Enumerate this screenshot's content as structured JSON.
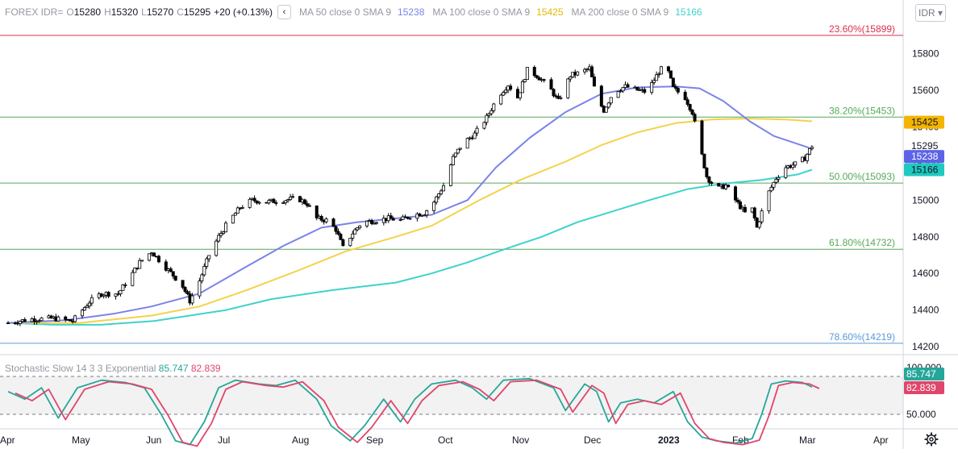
{
  "header": {
    "symbol": "FOREX IDR=",
    "open_label": "O",
    "open": "15280",
    "high_label": "H",
    "high": "15320",
    "low_label": "L",
    "low": "15270",
    "close_label": "C",
    "close": "15295",
    "change": "+20 (+0.13%)",
    "collapse_icon": "‹",
    "ma50_label": "MA 50 close 0 SMA 9",
    "ma50_value": "15238",
    "ma100_label": "MA 100 close 0 SMA 9",
    "ma100_value": "15425",
    "ma200_label": "MA 200 close 0 SMA 9",
    "ma200_value": "15166",
    "currency_button": "IDR ▾"
  },
  "colors": {
    "up": "#ffffff",
    "down": "#000000",
    "candle_border": "#000000",
    "ma50": "#7b83e8",
    "ma100": "#f4d24c",
    "ma200": "#3fd2cb",
    "fib_red": "#d9304f",
    "fib_green": "#57a85a",
    "fib_blue": "#5b9bd5",
    "stoch_k": "#26a69a",
    "stoch_d": "#e0456b"
  },
  "stochastic": {
    "label": "Stochastic Slow 14 3 3 Exponential",
    "k_value": "85.747",
    "d_value": "82.839",
    "axis_labels": [
      "100.000",
      "50.000"
    ]
  },
  "settings_icon": "gear-icon",
  "chart_data": {
    "type": "candlestick",
    "x_tick_labels": [
      "Apr",
      "May",
      "Jun",
      "Jul",
      "Aug",
      "Sep",
      "Oct",
      "Nov",
      "Dec",
      "2023",
      "Feb",
      "Mar",
      "Apr"
    ],
    "y_tick_labels": [
      "15800",
      "15600",
      "15400",
      "15200",
      "15000",
      "14800",
      "14600",
      "14400",
      "14200"
    ],
    "ylim": [
      14170,
      15960
    ],
    "fib_levels": [
      {
        "label": "23.60%(15899)",
        "value": 15899,
        "color": "fib_red"
      },
      {
        "label": "38.20%(15453)",
        "value": 15453,
        "color": "fib_green"
      },
      {
        "label": "50.00%(15093)",
        "value": 15093,
        "color": "fib_green"
      },
      {
        "label": "61.80%(14732)",
        "value": 14732,
        "color": "fib_green"
      },
      {
        "label": "78.60%(14219)",
        "value": 14219,
        "color": "fib_blue"
      }
    ],
    "price_badges": [
      {
        "text": "15425",
        "value": 15425,
        "bg": "#f4b400",
        "fg": "#131722"
      },
      {
        "text": "15295",
        "value": 15295,
        "bg": "#ffffff",
        "fg": "#131722"
      },
      {
        "text": "15238",
        "value": 15238,
        "bg": "#5d63e6",
        "fg": "#ffffff"
      },
      {
        "text": "15166",
        "value": 15166,
        "bg": "#1ec9c0",
        "fg": "#131722"
      }
    ],
    "price_keypoints": [
      [
        "2022-04-01",
        14330
      ],
      [
        "2022-04-10",
        14350
      ],
      [
        "2022-04-20",
        14355
      ],
      [
        "2022-04-28",
        14340
      ],
      [
        "2022-05-05",
        14445
      ],
      [
        "2022-05-10",
        14490
      ],
      [
        "2022-05-17",
        14490
      ],
      [
        "2022-05-22",
        14580
      ],
      [
        "2022-05-26",
        14660
      ],
      [
        "2022-05-31",
        14720
      ],
      [
        "2022-06-04",
        14660
      ],
      [
        "2022-06-09",
        14590
      ],
      [
        "2022-06-13",
        14530
      ],
      [
        "2022-06-16",
        14450
      ],
      [
        "2022-06-20",
        14560
      ],
      [
        "2022-06-24",
        14700
      ],
      [
        "2022-06-28",
        14800
      ],
      [
        "2022-07-02",
        14880
      ],
      [
        "2022-07-07",
        14960
      ],
      [
        "2022-07-12",
        15000
      ],
      [
        "2022-07-18",
        14990
      ],
      [
        "2022-07-25",
        15000
      ],
      [
        "2022-07-31",
        15010
      ],
      [
        "2022-08-04",
        14980
      ],
      [
        "2022-08-08",
        14900
      ],
      [
        "2022-08-12",
        14890
      ],
      [
        "2022-08-16",
        14840
      ],
      [
        "2022-08-19",
        14740
      ],
      [
        "2022-08-23",
        14820
      ],
      [
        "2022-08-27",
        14880
      ],
      [
        "2022-09-02",
        14890
      ],
      [
        "2022-09-07",
        14900
      ],
      [
        "2022-09-12",
        14890
      ],
      [
        "2022-09-17",
        14920
      ],
      [
        "2022-09-22",
        14930
      ],
      [
        "2022-09-26",
        14990
      ],
      [
        "2022-09-30",
        15080
      ],
      [
        "2022-10-04",
        15230
      ],
      [
        "2022-10-08",
        15310
      ],
      [
        "2022-10-13",
        15360
      ],
      [
        "2022-10-18",
        15450
      ],
      [
        "2022-10-23",
        15570
      ],
      [
        "2022-10-27",
        15630
      ],
      [
        "2022-10-31",
        15560
      ],
      [
        "2022-11-04",
        15710
      ],
      [
        "2022-11-08",
        15680
      ],
      [
        "2022-11-13",
        15620
      ],
      [
        "2022-11-17",
        15540
      ],
      [
        "2022-11-22",
        15680
      ],
      [
        "2022-11-27",
        15700
      ],
      [
        "2022-11-30",
        15720
      ],
      [
        "2022-12-03",
        15560
      ],
      [
        "2022-12-06",
        15490
      ],
      [
        "2022-12-10",
        15590
      ],
      [
        "2022-12-15",
        15620
      ],
      [
        "2022-12-20",
        15600
      ],
      [
        "2022-12-24",
        15590
      ],
      [
        "2022-12-29",
        15700
      ],
      [
        "2023-01-01",
        15740
      ],
      [
        "2023-01-04",
        15610
      ],
      [
        "2023-01-09",
        15560
      ],
      [
        "2023-01-12",
        15480
      ],
      [
        "2023-01-15",
        15300
      ],
      [
        "2023-01-18",
        15130
      ],
      [
        "2023-01-22",
        15060
      ],
      [
        "2023-01-26",
        15080
      ],
      [
        "2023-01-30",
        15000
      ],
      [
        "2023-02-03",
        14930
      ],
      [
        "2023-02-06",
        14950
      ],
      [
        "2023-02-08",
        14850
      ],
      [
        "2023-02-12",
        15020
      ],
      [
        "2023-02-16",
        15120
      ],
      [
        "2023-02-20",
        15180
      ],
      [
        "2023-02-25",
        15200
      ],
      [
        "2023-02-28",
        15230
      ],
      [
        "2023-03-03",
        15295
      ]
    ],
    "ma_keypoints": {
      "ma50": [
        [
          "2022-04-01",
          14330
        ],
        [
          "2022-04-25",
          14345
        ],
        [
          "2022-05-15",
          14380
        ],
        [
          "2022-05-31",
          14420
        ],
        [
          "2022-06-20",
          14490
        ],
        [
          "2022-07-10",
          14640
        ],
        [
          "2022-07-25",
          14750
        ],
        [
          "2022-08-10",
          14850
        ],
        [
          "2022-08-25",
          14880
        ],
        [
          "2022-09-10",
          14900
        ],
        [
          "2022-09-25",
          14920
        ],
        [
          "2022-10-10",
          15000
        ],
        [
          "2022-10-22",
          15180
        ],
        [
          "2022-11-05",
          15340
        ],
        [
          "2022-11-20",
          15480
        ],
        [
          "2022-12-05",
          15580
        ],
        [
          "2022-12-20",
          15615
        ],
        [
          "2023-01-05",
          15620
        ],
        [
          "2023-01-15",
          15610
        ],
        [
          "2023-01-25",
          15540
        ],
        [
          "2023-02-05",
          15430
        ],
        [
          "2023-02-15",
          15350
        ],
        [
          "2023-03-03",
          15280
        ]
      ],
      "ma100": [
        [
          "2022-04-01",
          14330
        ],
        [
          "2022-05-01",
          14330
        ],
        [
          "2022-05-31",
          14370
        ],
        [
          "2022-06-20",
          14420
        ],
        [
          "2022-07-10",
          14510
        ],
        [
          "2022-08-01",
          14620
        ],
        [
          "2022-08-20",
          14720
        ],
        [
          "2022-09-10",
          14800
        ],
        [
          "2022-09-25",
          14860
        ],
        [
          "2022-10-15",
          15000
        ],
        [
          "2022-11-01",
          15110
        ],
        [
          "2022-11-20",
          15210
        ],
        [
          "2022-12-05",
          15300
        ],
        [
          "2022-12-20",
          15370
        ],
        [
          "2023-01-05",
          15420
        ],
        [
          "2023-01-20",
          15440
        ],
        [
          "2023-02-05",
          15445
        ],
        [
          "2023-02-20",
          15440
        ],
        [
          "2023-03-03",
          15430
        ]
      ],
      "ma200": [
        [
          "2022-04-01",
          14330
        ],
        [
          "2022-04-20",
          14320
        ],
        [
          "2022-05-10",
          14320
        ],
        [
          "2022-06-01",
          14340
        ],
        [
          "2022-07-01",
          14400
        ],
        [
          "2022-07-20",
          14460
        ],
        [
          "2022-08-15",
          14510
        ],
        [
          "2022-09-10",
          14550
        ],
        [
          "2022-09-25",
          14600
        ],
        [
          "2022-10-10",
          14660
        ],
        [
          "2022-10-25",
          14730
        ],
        [
          "2022-11-10",
          14800
        ],
        [
          "2022-11-25",
          14880
        ],
        [
          "2022-12-10",
          14940
        ],
        [
          "2022-12-25",
          15000
        ],
        [
          "2023-01-10",
          15060
        ],
        [
          "2023-01-25",
          15090
        ],
        [
          "2023-02-10",
          15110
        ],
        [
          "2023-02-25",
          15140
        ],
        [
          "2023-03-03",
          15166
        ]
      ]
    },
    "stoch_keypoints": [
      [
        "2022-04-01",
        80
      ],
      [
        "2022-04-08",
        70
      ],
      [
        "2022-04-15",
        85
      ],
      [
        "2022-04-22",
        45
      ],
      [
        "2022-04-30",
        85
      ],
      [
        "2022-05-10",
        95
      ],
      [
        "2022-05-20",
        92
      ],
      [
        "2022-05-28",
        85
      ],
      [
        "2022-06-04",
        50
      ],
      [
        "2022-06-10",
        15
      ],
      [
        "2022-06-16",
        10
      ],
      [
        "2022-06-22",
        40
      ],
      [
        "2022-06-28",
        85
      ],
      [
        "2022-07-05",
        95
      ],
      [
        "2022-07-15",
        90
      ],
      [
        "2022-07-22",
        88
      ],
      [
        "2022-07-30",
        95
      ],
      [
        "2022-08-08",
        70
      ],
      [
        "2022-08-14",
        35
      ],
      [
        "2022-08-22",
        15
      ],
      [
        "2022-08-28",
        35
      ],
      [
        "2022-09-05",
        70
      ],
      [
        "2022-09-12",
        40
      ],
      [
        "2022-09-18",
        70
      ],
      [
        "2022-09-25",
        90
      ],
      [
        "2022-10-05",
        95
      ],
      [
        "2022-10-12",
        85
      ],
      [
        "2022-10-18",
        70
      ],
      [
        "2022-10-25",
        95
      ],
      [
        "2022-11-05",
        97
      ],
      [
        "2022-11-15",
        85
      ],
      [
        "2022-11-20",
        55
      ],
      [
        "2022-11-28",
        90
      ],
      [
        "2022-12-03",
        80
      ],
      [
        "2022-12-08",
        40
      ],
      [
        "2022-12-13",
        65
      ],
      [
        "2022-12-20",
        70
      ],
      [
        "2022-12-27",
        65
      ],
      [
        "2023-01-04",
        80
      ],
      [
        "2023-01-10",
        40
      ],
      [
        "2023-01-16",
        20
      ],
      [
        "2023-01-22",
        15
      ],
      [
        "2023-01-30",
        12
      ],
      [
        "2023-02-06",
        18
      ],
      [
        "2023-02-10",
        50
      ],
      [
        "2023-02-14",
        90
      ],
      [
        "2023-02-20",
        94
      ],
      [
        "2023-02-27",
        92
      ],
      [
        "2023-03-03",
        86
      ]
    ]
  }
}
